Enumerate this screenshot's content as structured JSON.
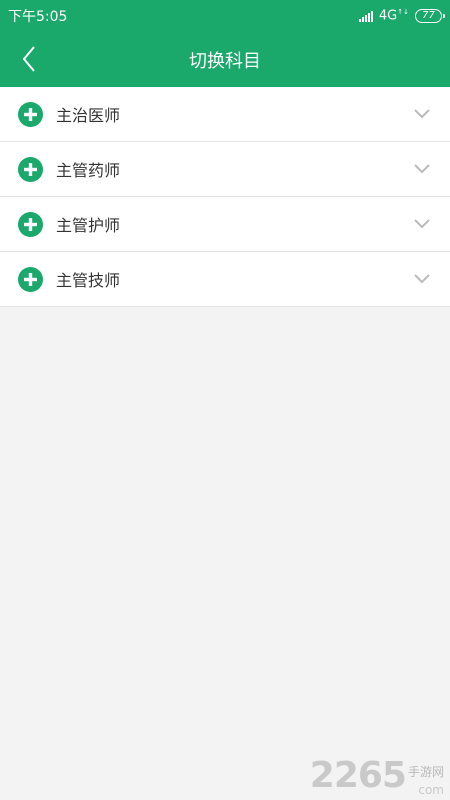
{
  "status_bar": {
    "time": "下午5:05",
    "network": "4G",
    "battery": "77"
  },
  "app_bar": {
    "title": "切换科目"
  },
  "subjects": [
    {
      "label": "主治医师"
    },
    {
      "label": "主管药师"
    },
    {
      "label": "主管护师"
    },
    {
      "label": "主管技师"
    }
  ],
  "watermark": {
    "number": "2265",
    "text": "手游网",
    "suffix": "com"
  },
  "colors": {
    "primary": "#1aa86b",
    "background": "#f3f3f3"
  }
}
